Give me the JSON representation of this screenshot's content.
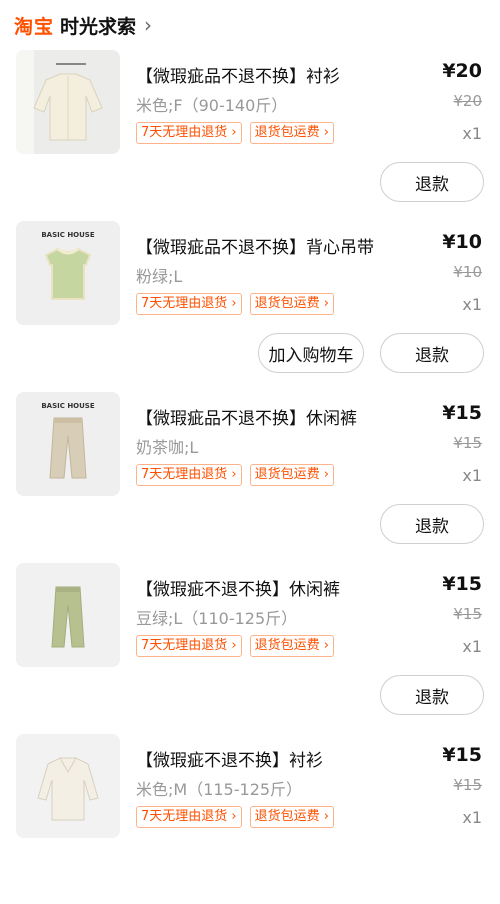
{
  "header": {
    "brand": "淘宝",
    "shop": "时光求索",
    "chevron": "›"
  },
  "tags": {
    "return": "7天无理由退货 ›",
    "freight": "退货包运费 ›"
  },
  "buttons": {
    "refund": "退款",
    "add_cart": "加入购物车"
  },
  "items": [
    {
      "title": "【微瑕疵品不退不换】衬衫",
      "attrs": "米色;F（90-140斤）",
      "price": "¥20",
      "orig_price": "¥20",
      "qty": "x1",
      "product": "cream-blouse"
    },
    {
      "title": "【微瑕疵品不退不换】背心吊带",
      "attrs": "粉绿;L",
      "price": "¥10",
      "orig_price": "¥10",
      "qty": "x1",
      "product": "green-vest",
      "thumb_brand": "BASIC HOUSE"
    },
    {
      "title": "【微瑕疵品不退不换】休闲裤",
      "attrs": "奶茶咖;L",
      "price": "¥15",
      "orig_price": "¥15",
      "qty": "x1",
      "product": "beige-trousers",
      "thumb_brand": "BASIC HOUSE"
    },
    {
      "title": "【微瑕疵不退不换】休闲裤",
      "attrs": "豆绿;L（110-125斤）",
      "price": "¥15",
      "orig_price": "¥15",
      "qty": "x1",
      "product": "green-trousers"
    },
    {
      "title": "【微瑕疵不退不换】衬衫",
      "attrs": "米色;M（115-125斤）",
      "price": "¥15",
      "orig_price": "¥15",
      "qty": "x1",
      "product": "cream-shirt"
    }
  ],
  "colors": {
    "accent": "#ff5000",
    "tag_border": "#ffb38a",
    "muted": "#999999"
  }
}
